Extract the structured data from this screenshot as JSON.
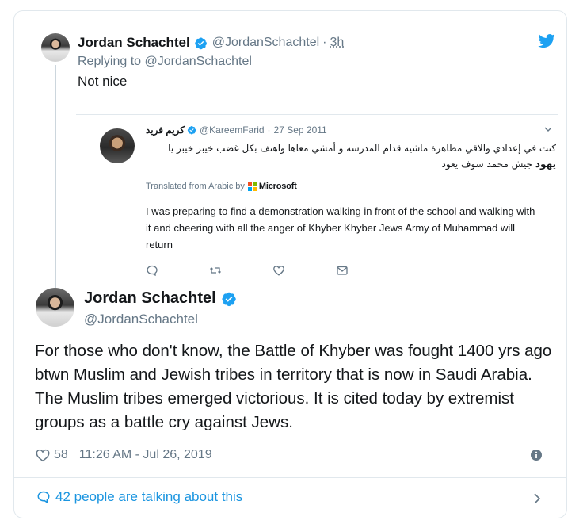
{
  "colors": {
    "verified": "#1da1f2",
    "link": "#1b95e0",
    "muted": "#657786",
    "text": "#14171a",
    "border": "#e1e8ed"
  },
  "reply": {
    "name": "Jordan Schachtel",
    "handle": "@JordanSchachtel",
    "separator": "·",
    "time": "3h",
    "replying_prefix": "Replying to",
    "replying_to": "@JordanSchachtel",
    "text": "Not nice",
    "icon": "twitter-bird-icon"
  },
  "quote": {
    "name": "كريم فريد",
    "handle": "@KareemFarid",
    "separator": "·",
    "date": "27 Sep 2011",
    "arabic_line1": "كنت في إعدادي والاقي مظاهرة ماشية قدام المدرسة و أمشي معاها واهتف بكل غضب خيبر خيبر يا",
    "arabic_bold": "يهود",
    "arabic_line1_end": "جيش",
    "arabic_line2": "محمد سوف يعود",
    "translated_prefix": "Translated from Arabic by",
    "translated_brand": "Microsoft",
    "translation": "I was preparing to find a demonstration walking in front of the school and walking with it and cheering with all the anger of Khyber Khyber Jews Army of Muhammad will return",
    "actions": [
      "reply-icon",
      "retweet-icon",
      "like-icon",
      "message-icon"
    ]
  },
  "main": {
    "name": "Jordan Schachtel",
    "handle": "@JordanSchachtel",
    "text": "For those who don't know, the Battle of Khyber was fought 1400 yrs ago btwn Muslim and Jewish tribes in territory that is now in Saudi Arabia. The Muslim tribes emerged victorious. It is cited today by extremist groups as a battle cry against Jews.",
    "likes": "58",
    "timestamp": "11:26 AM - Jul 26, 2019"
  },
  "footer": {
    "talking": "42 people are talking about this"
  }
}
